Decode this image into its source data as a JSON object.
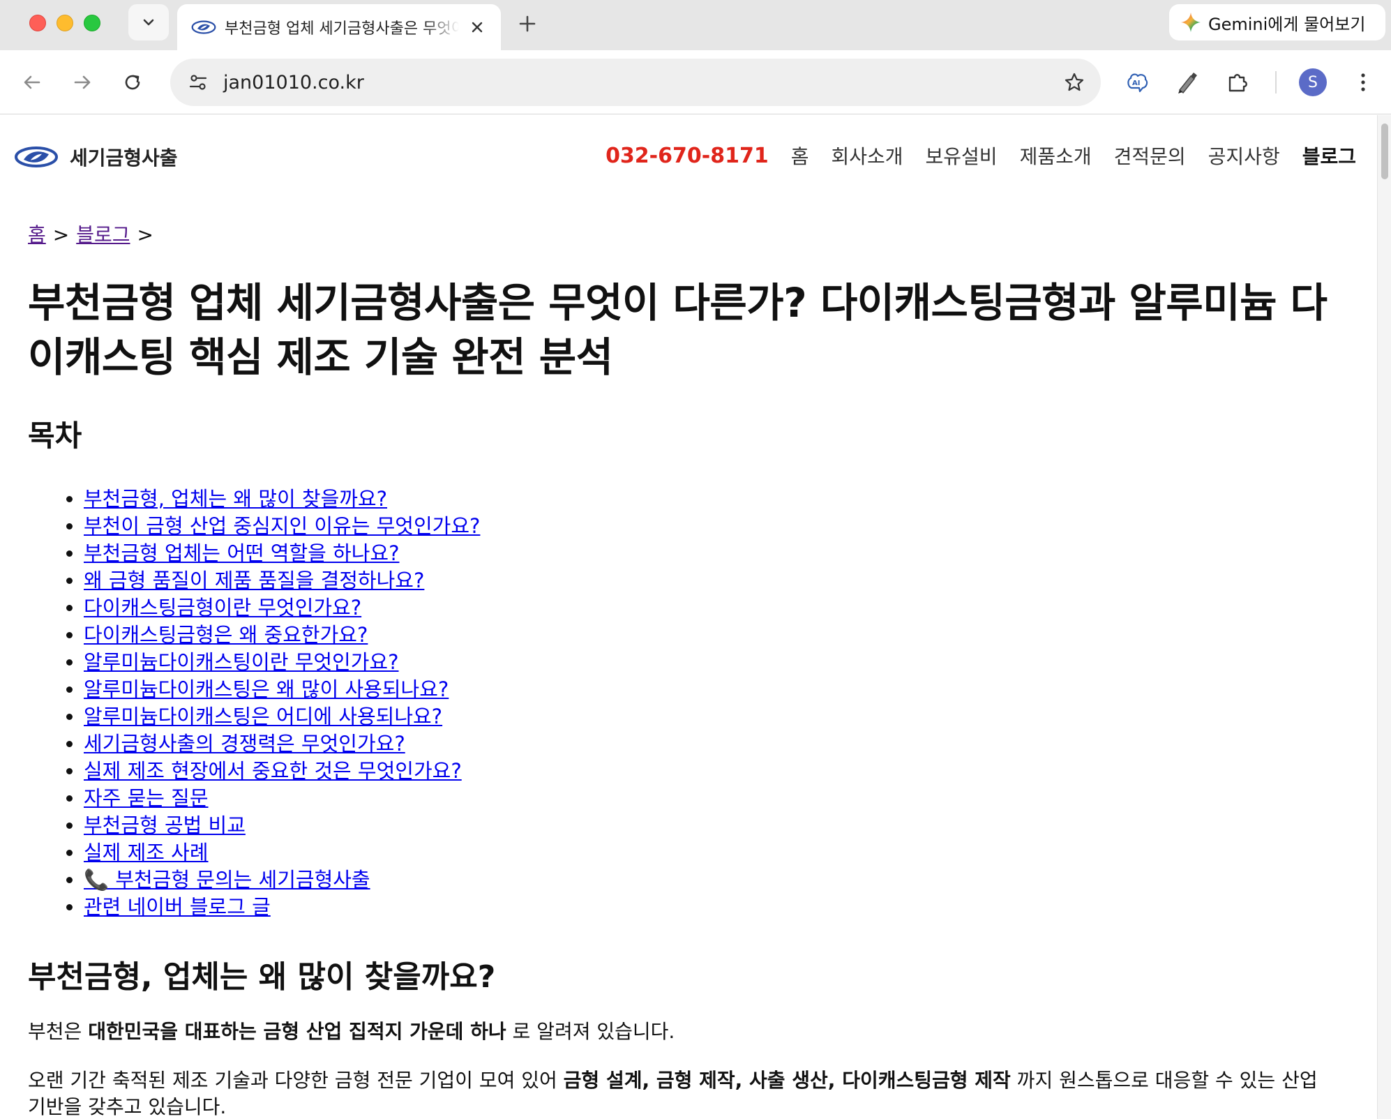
{
  "browser": {
    "tab": {
      "title": "부천금형 업체 세기금형사출은 무엇이 다른가? 다이캐스팅금형과 알루미늄",
      "close_icon": "close-icon"
    },
    "gemini_button_label": "Gemini에게 물어보기",
    "url": "jan01010.co.kr",
    "profile_initial": "S",
    "colors": {
      "tab_strip": "#e6e6e6",
      "avatar": "#5b6bc7"
    }
  },
  "site": {
    "logo_text": "세기금형사출",
    "nav": {
      "phone": "032-670-8171",
      "items": [
        "홈",
        "회사소개",
        "보유설비",
        "제품소개",
        "견적문의",
        "공지사항",
        "블로그"
      ],
      "active_item": "블로그"
    },
    "colors": {
      "phone": "#e0251b",
      "link": "#0000ee",
      "visited_link": "#551a8b"
    }
  },
  "breadcrumb": {
    "home": "홈",
    "sep1": ">",
    "blog": "블로그",
    "sep2": ">"
  },
  "post": {
    "title": "부천금형 업체 세기금형사출은 무엇이 다른가? 다이캐스팅금형과 알루미늄 다이캐스팅 핵심 제조 기술 완전 분석",
    "toc_heading": "목차",
    "toc": [
      "부천금형, 업체는 왜 많이 찾을까요?",
      "부천이 금형 산업 중심지인 이유는 무엇인가요?",
      "부천금형 업체는 어떤 역할을 하나요?",
      "왜 금형 품질이 제품 품질을 결정하나요?",
      "다이캐스팅금형이란 무엇인가요?",
      "다이캐스팅금형은 왜 중요한가요?",
      "알루미늄다이캐스팅이란 무엇인가요?",
      "알루미늄다이캐스팅은 왜 많이 사용되나요?",
      "알루미늄다이캐스팅은 어디에 사용되나요?",
      "세기금형사출의 경쟁력은 무엇인가요?",
      "실제 제조 현장에서 중요한 것은 무엇인가요?",
      "자주 묻는 질문",
      "부천금형 공법 비교",
      "실제 제조 사례",
      "📞 부천금형 문의는 세기금형사출",
      "관련 네이버 블로그 글"
    ],
    "section1": {
      "heading": "부천금형, 업체는 왜 많이 찾을까요?",
      "para1": {
        "before": "부천은 ",
        "bold": "대한민국을 대표하는 금형 산업 집적지 가운데 하나",
        "after": " 로 알려져 있습니다."
      },
      "para2": {
        "before": "오랜 기간 축적된 제조 기술과 다양한 금형 전문 기업이 모여 있어 ",
        "bold": "금형 설계, 금형 제작, 사출 생산, 다이캐스팅금형 제작",
        "after": " 까지 원스톱으로 대응할 수 있는 산업 기반을 갖추고 있습니다."
      }
    }
  }
}
